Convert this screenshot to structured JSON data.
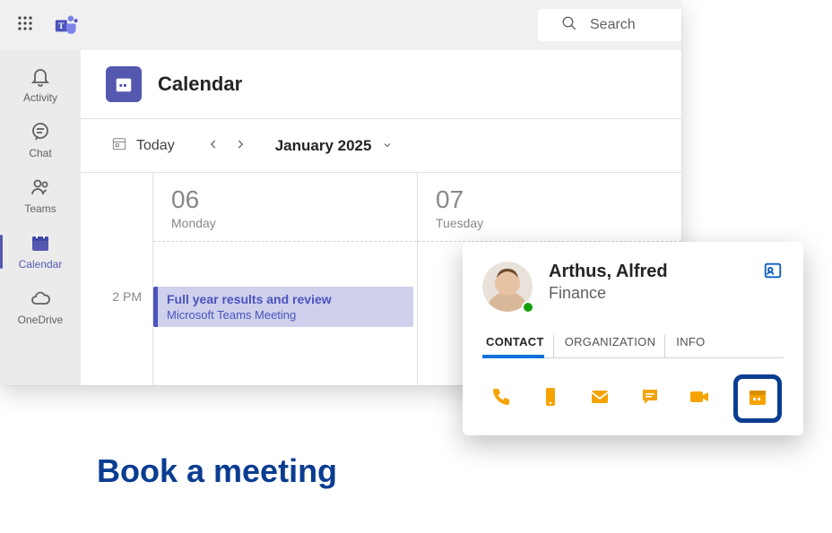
{
  "search": {
    "placeholder": "Search"
  },
  "sidebar": {
    "activity": "Activity",
    "chat": "Chat",
    "teams": "Teams",
    "calendar": "Calendar",
    "onedrive": "OneDrive"
  },
  "calendar": {
    "title": "Calendar",
    "today": "Today",
    "month_label": "January 2025",
    "days": [
      {
        "num": "06",
        "name": "Monday"
      },
      {
        "num": "07",
        "name": "Tuesday"
      }
    ],
    "time_label": "2 PM",
    "event": {
      "title": "Full year results and review",
      "subtitle": "Microsoft Teams Meeting"
    }
  },
  "contact_card": {
    "name": "Arthus, Alfred",
    "department": "Finance",
    "tabs": {
      "contact": "CONTACT",
      "organization": "ORGANIZATION",
      "info": "INFO"
    }
  },
  "caption": "Book a meeting"
}
